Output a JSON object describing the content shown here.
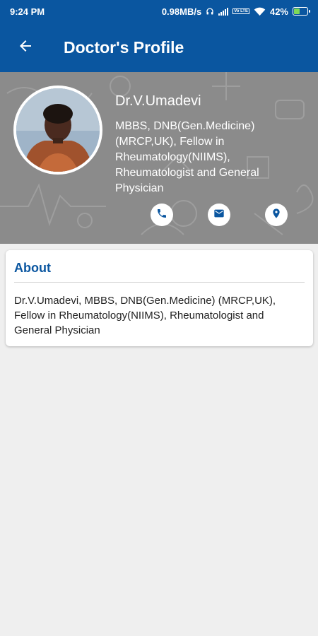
{
  "status_bar": {
    "time": "9:24 PM",
    "speed": "0.98MB/s",
    "network_label": "Vo LTE",
    "battery": "42%",
    "battery_level": 0.42
  },
  "header": {
    "title": "Doctor's Profile",
    "back_icon": "arrow-left-icon"
  },
  "doctor": {
    "name": "Dr.V.Umadevi",
    "qualifications": "MBBS, DNB(Gen.Medicine) (MRCP,UK), Fellow in Rheumatology(NIIMS), Rheumatologist and General Physician",
    "actions": [
      {
        "icon": "phone-icon"
      },
      {
        "icon": "email-icon"
      },
      {
        "icon": "location-pin-icon"
      }
    ]
  },
  "about": {
    "title": "About",
    "text": "Dr.V.Umadevi, MBBS, DNB(Gen.Medicine) (MRCP,UK), Fellow in Rheumatology(NIIMS), Rheumatologist and General Physician"
  },
  "colors": {
    "primary": "#0a56a0",
    "hero_bg": "#8b8b8b",
    "page_bg": "#efefef"
  }
}
